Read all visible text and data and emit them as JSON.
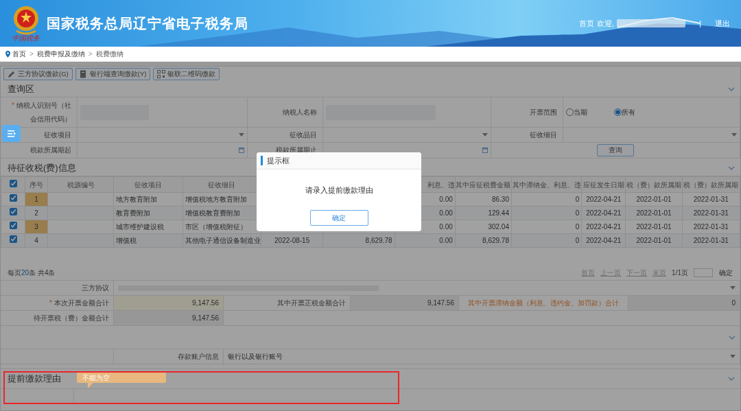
{
  "header": {
    "title": "国家税务总局辽宁省电子税务局",
    "emblem_caption": "中国税务",
    "home": "首页",
    "welcome": "欢迎,",
    "separator": "|",
    "logout": "退出"
  },
  "breadcrumb": {
    "separator": ">",
    "items": [
      {
        "label": "首页"
      },
      {
        "label": "税费申报及缴纳"
      },
      {
        "label": "税费缴纳"
      }
    ]
  },
  "toolbar": [
    {
      "label": "三方协议缴款(G)",
      "kind": "pencil"
    },
    {
      "label": "银行端查询缴款(Y)",
      "kind": "document"
    },
    {
      "label": "银联二维码缴款",
      "kind": "qr"
    }
  ],
  "query": {
    "title": "查询区",
    "required_mark": "*",
    "rows": [
      [
        {
          "label": "纳税人识别号（社会信用代码）",
          "required": true,
          "kind": "redacted"
        },
        {
          "label": "纳税人名称",
          "required": false,
          "kind": "redacted"
        },
        {
          "label": "开票范围",
          "required": false,
          "kind": "radio",
          "options": [
            {
              "label": "当期",
              "selected": false
            },
            {
              "label": "所有",
              "selected": true
            }
          ]
        }
      ],
      [
        {
          "label": "征收项目",
          "required": false,
          "kind": "select"
        },
        {
          "label": "征收品目",
          "required": false,
          "kind": "select"
        },
        {
          "label": "征收细目",
          "required": false,
          "kind": "select"
        }
      ],
      [
        {
          "label": "税款所属期起",
          "required": false,
          "kind": "date"
        },
        {
          "label": "税款所属期止",
          "required": false,
          "kind": "date"
        },
        {
          "kind": "button",
          "label": "查询"
        }
      ]
    ]
  },
  "table": {
    "title": "待征收税(费)信息",
    "header_checked": true,
    "columns": [
      {
        "label": "序号"
      },
      {
        "label": "税源编号"
      },
      {
        "label": "征收项目"
      },
      {
        "label": "征收细目"
      },
      {},
      {},
      {
        "label": "利息、违"
      },
      {
        "label": "其中应征税费金额"
      },
      {
        "label": "其中滞纳金、利息、违"
      },
      {
        "label": "应征发生日期"
      },
      {
        "label": "税（费）款所属期"
      },
      {
        "label": "税（费）款所属期"
      }
    ],
    "rows": [
      {
        "checked": true,
        "seq": "1",
        "item": "地方教育附加",
        "detail": "增值税地方教育附加",
        "column_8": "0.00",
        "amount": "86.30",
        "late_fee": "0",
        "occur_date": "2022-04-21",
        "period_start": "2022-01-01",
        "period_end": "2022-01-31"
      },
      {
        "checked": true,
        "seq": "2",
        "item": "教育费附加",
        "detail": "增值税教育费附加",
        "column_8": "0.00",
        "amount": "129.44",
        "late_fee": "0",
        "occur_date": "2022-04-21",
        "period_start": "2022-01-01",
        "period_end": "2022-01-31"
      },
      {
        "checked": true,
        "seq": "3",
        "item": "城市维护建设税",
        "detail": "市区（增值税附征）",
        "column_8": "0.00",
        "amount": "302.04",
        "late_fee": "0",
        "occur_date": "2022-04-21",
        "period_start": "2022-01-01",
        "period_end": "2022-01-31"
      },
      {
        "checked": true,
        "seq": "4",
        "item": "增值税",
        "detail": "其他电子通信设备制造业",
        "column_6": "2022-08-15",
        "column_7": "8,629.78",
        "column_8": "0.00",
        "amount": "8,629.78",
        "late_fee": "0",
        "occur_date": "2022-04-21",
        "period_start": "2022-01-01",
        "period_end": "2022-01-31"
      }
    ]
  },
  "pagination": {
    "per_page_prefix": "每页",
    "per_page": "20",
    "per_page_suffix": "条 共4条",
    "nav": [
      "首页",
      "上一页",
      "下一页",
      "末页"
    ],
    "page_info": "1/1页",
    "confirm": "确定"
  },
  "agreement": {
    "label": "三方协议"
  },
  "totals": {
    "required_mark": "*",
    "invoice_total_label": "本次开票金额合计",
    "invoice_total": "9,147.56",
    "principal_label": "其中开票正税金额合计",
    "principal": "9,147.56",
    "late_label": "其中开票滞纳金额（利息、违约金、加罚款）合计",
    "late": "0",
    "pending_label": "待开票税（费）金额合计",
    "pending": "9,147.56"
  },
  "account": {
    "label": "存款账户信息",
    "placeholder": "银行以及银行账号"
  },
  "reason": {
    "title": "提前缴款理由",
    "tooltip": "不能为空"
  },
  "modal": {
    "title": "提示框",
    "message": "请录入提前缴款理由",
    "button": "确定"
  }
}
